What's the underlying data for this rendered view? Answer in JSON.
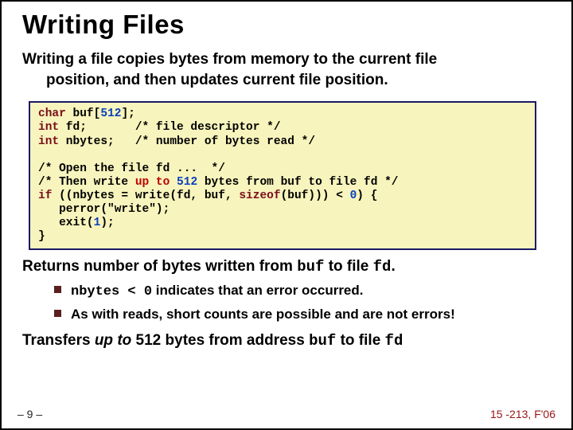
{
  "title": "Writing Files",
  "subtitle_line1": "Writing a file copies bytes from memory to the current file",
  "subtitle_line2": "position, and then updates current file position.",
  "code": {
    "l1a": "char",
    "l1b": " buf[",
    "l1n": "512",
    "l1c": "];",
    "l2a": "int",
    "l2b": " fd;       /* file descriptor */",
    "l3a": "int",
    "l3b": " nbytes;   /* number of bytes read */",
    "blank": "",
    "l5": "/* Open the file fd ...  */",
    "l6a": "/* Then write ",
    "l6red": "up to",
    "l6b": " ",
    "l6n": "512",
    "l6c": " bytes from buf to file fd */",
    "l7a": "if",
    "l7b": " ((nbytes = write(fd, buf, ",
    "l7c": "sizeof",
    "l7d": "(buf))) < ",
    "l7n": "0",
    "l7e": ") {",
    "l8": "   perror(\"write\");",
    "l9a": "   exit(",
    "l9n": "1",
    "l9b": ");",
    "l10": "}"
  },
  "returns_a": "Returns number of bytes written from ",
  "returns_buf": "buf",
  "returns_b": " to file ",
  "returns_fd": "fd",
  "returns_dot": ".",
  "bullet1_a": "nbytes < 0",
  "bullet1_b": " indicates that an error occurred.",
  "bullet2": "As with reads, short counts are possible and are not errors!",
  "transfers_a": "Transfers ",
  "transfers_upto": "up to",
  "transfers_b": " 512 bytes from address ",
  "transfers_buf": "buf",
  "transfers_c": " to file ",
  "transfers_fd": "fd",
  "footer_left": "– 9 –",
  "footer_right": "15 -213, F'06"
}
